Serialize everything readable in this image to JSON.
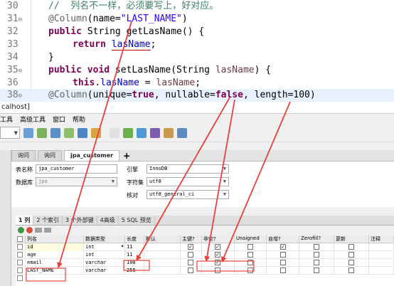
{
  "editor": {
    "lines": [
      {
        "num": "30",
        "marker": "",
        "comment": "//  列名不一样，必须要写上，好对应。"
      },
      {
        "num": "31",
        "marker": "⊖",
        "annotation": "@Column",
        "open": "(name=",
        "string": "\"LAST_NAME\"",
        "close": ")"
      },
      {
        "num": "32",
        "marker": "",
        "kw1": "public",
        "type": " String ",
        "method": "getLasName() {"
      },
      {
        "num": "33",
        "marker": "",
        "kw1": "return",
        "field": "lasName",
        "semi": ";"
      },
      {
        "num": "34",
        "marker": "",
        "text": "}"
      },
      {
        "num": "35",
        "marker": "⊖",
        "kw1": "public",
        "kw2": "void",
        "method": " setLasName(String ",
        "param": "lasName",
        "close": ") {"
      },
      {
        "num": "36",
        "marker": "",
        "kw1": "this",
        "dot": ".",
        "field": "lasName",
        "eq": " = ",
        "param": "lasName",
        "semi": ";"
      },
      {
        "num": "37",
        "marker": "",
        "text": "}"
      },
      {
        "num": "38",
        "marker": "⊖",
        "annotation": "@Column",
        "p1": "(unique=",
        "t1": "true",
        "p2": ", nullable=",
        "t2": "false",
        "p3": ", length=100)"
      }
    ]
  },
  "window": {
    "title": "calhost]",
    "menu": [
      "工具",
      "高级工具",
      "窗口",
      "帮助"
    ]
  },
  "doc_tabs": [
    {
      "label": "询问"
    },
    {
      "label": "询问"
    },
    {
      "label": "jpa_customer"
    },
    {
      "label": "+"
    }
  ],
  "form": {
    "table_name_label": "表名称",
    "table_name_value": "jpa_customer",
    "database_label": "数据库",
    "database_value": "jpa",
    "engine_label": "引擎",
    "engine_value": "InnoDB",
    "charset_label": "字符集",
    "charset_value": "utf8",
    "collation_label": "核对",
    "collation_value": "utf8_general_ci"
  },
  "sub_tabs": [
    {
      "label": "1 列"
    },
    {
      "label": "2 个索引"
    },
    {
      "label": "3 个外部键"
    },
    {
      "label": "4高级"
    },
    {
      "label": "5 SQL 预览"
    }
  ],
  "grid": {
    "headers": [
      "列名",
      "数据类型",
      "长度",
      "默认",
      "主键?",
      "非空?",
      "Unsigned",
      "自增?",
      "Zerofill?",
      "更新",
      "注释"
    ],
    "rows": [
      {
        "name": "id",
        "type": "int",
        "length": "11",
        "pk": true,
        "nn": true,
        "ai": true
      },
      {
        "name": "age",
        "type": "int",
        "length": "11",
        "pk": false,
        "nn": true,
        "ai": false
      },
      {
        "name": "email",
        "type": "varchar",
        "length": "100",
        "pk": false,
        "nn": true,
        "ai": false
      },
      {
        "name": "LAST_NAME",
        "type": "varchar",
        "length": "255",
        "pk": false,
        "nn": false,
        "ai": false
      }
    ]
  },
  "colors": {
    "keyword": "#7f0055",
    "comment": "#3f7f5f",
    "string": "#2a00ff",
    "field": "#0000c0",
    "annotation_arrow": "#e8413c"
  }
}
